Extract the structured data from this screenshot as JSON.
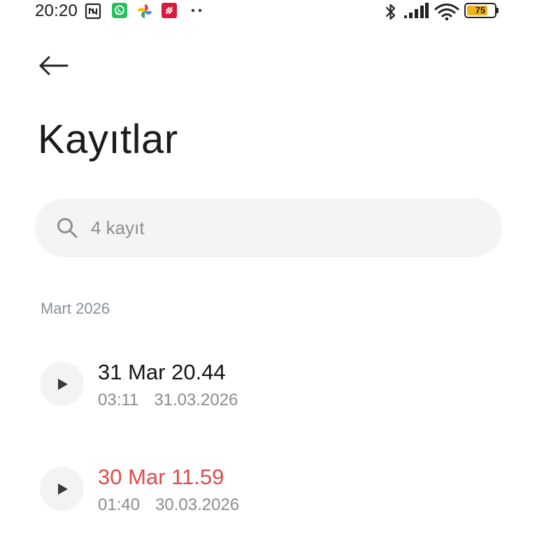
{
  "status_bar": {
    "time": "20:20",
    "battery_level": "75",
    "battery_fraction": 0.75,
    "battery_color": "#f2b21b",
    "notification_icons": [
      "nfc-icon",
      "whatsapp-icon",
      "photos-icon",
      "app-icon",
      "more-notifications-icon"
    ],
    "system_icons": [
      "bluetooth-icon",
      "signal-icon",
      "wifi-icon",
      "battery-icon"
    ]
  },
  "header": {
    "back_icon": "back-arrow-icon",
    "title": "Kayıtlar"
  },
  "search": {
    "icon": "search-icon",
    "value": "",
    "placeholder": "4 kayıt"
  },
  "sections": [
    {
      "header": "Mart 2026",
      "recordings": [
        {
          "title": "31 Mar 20.44",
          "duration": "03:11",
          "date": "31.03.2026",
          "title_color": "#141414",
          "icon": "play-icon"
        },
        {
          "title": "30 Mar 11.59",
          "duration": "01:40",
          "date": "30.03.2026",
          "title_color": "#e04a4a",
          "icon": "play-icon"
        }
      ]
    }
  ]
}
